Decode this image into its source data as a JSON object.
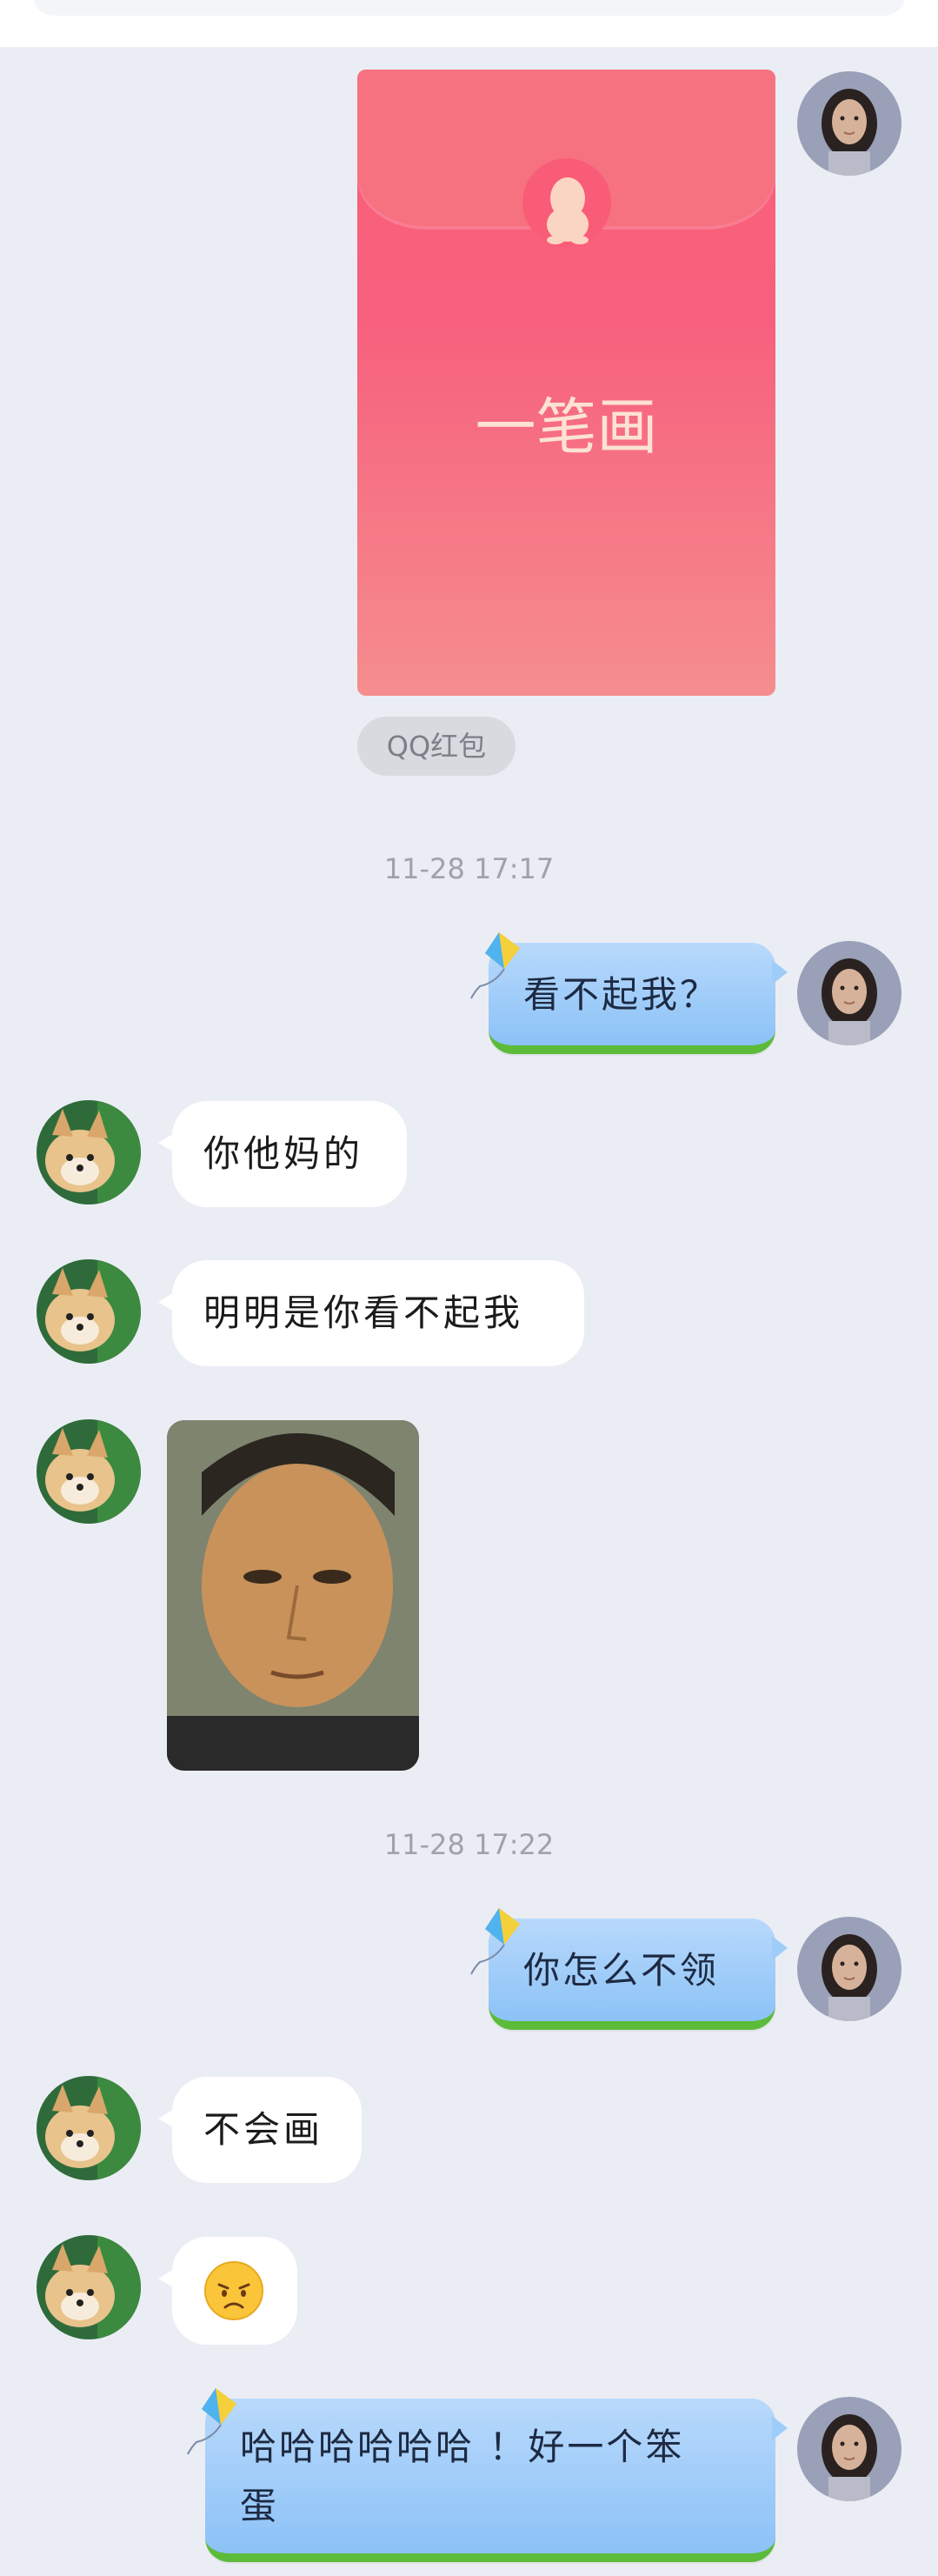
{
  "red_packet": {
    "title": "一笔画",
    "tag": "QQ红包"
  },
  "timestamps": [
    "11-28 17:17",
    "11-28 17:22"
  ],
  "messages": {
    "m1": "看不起我？",
    "m2": "你他妈的",
    "m3": "明明是你看不起我",
    "m4": "你怎么不领",
    "m5": "不会画",
    "m6_emoji_name": "disappointed-face-emoji",
    "m7_line1": "哈哈哈哈哈哈 ！好一个笨",
    "m7_line2": "蛋"
  },
  "colors": {
    "background": "#ebedf5",
    "packet_red": "#f96178",
    "packet_text": "#fde2d3",
    "bubble_blue": "#9fcdf9",
    "bubble_grass": "#5cbb39",
    "bubble_white": "#ffffff",
    "timestamp": "#9fa2aa"
  },
  "icons": {
    "self_avatar": "woman-portrait-avatar",
    "friend_avatar": "corgi-dog-avatar",
    "kite": "kite-icon",
    "penguin": "qq-penguin-icon"
  }
}
